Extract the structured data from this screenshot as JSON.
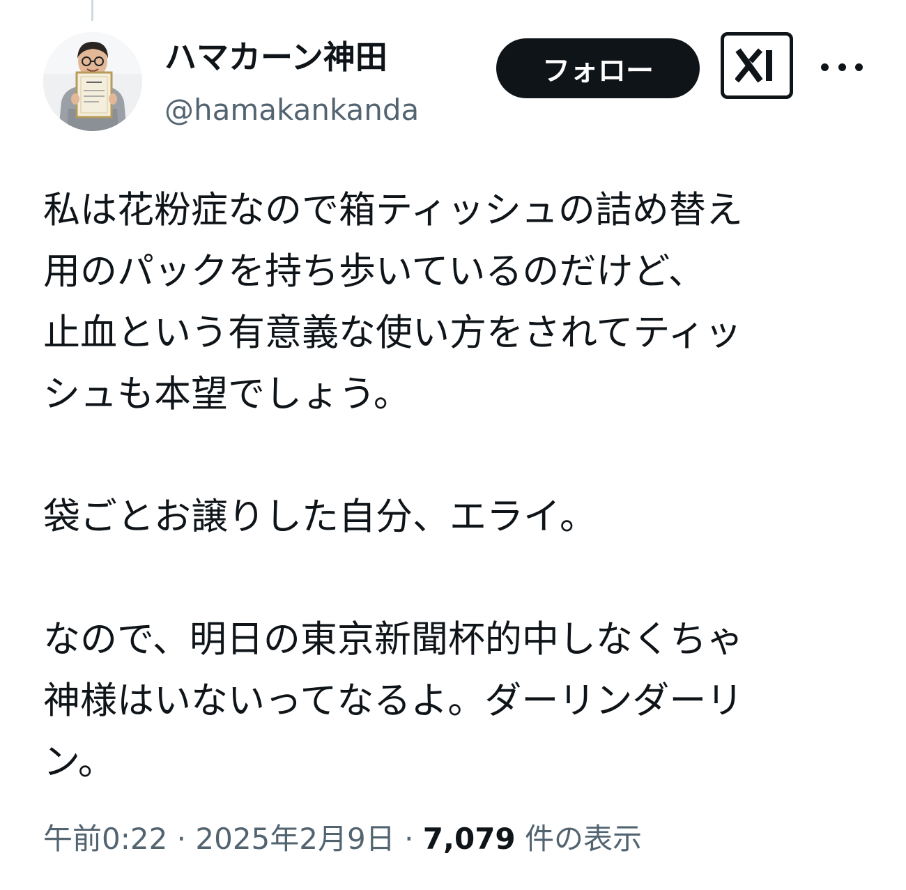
{
  "author": {
    "display_name": "ハマカーン神田",
    "handle": "@hamakankanda",
    "avatar_icon": "avatar-photo-holding-certificate"
  },
  "actions": {
    "follow_label": "フォロー",
    "grok_icon": "grok-icon",
    "more_icon": "more-dots-icon"
  },
  "tweet": {
    "paragraphs": [
      [
        "私は花粉症なので箱ティッシュの詰め替え",
        "用のパックを持ち歩いているのだけど、",
        "止血という有意義な使い方をされてティッ",
        "シュも本望でしょう。"
      ],
      [
        "袋ごとお譲りした自分、エライ。"
      ],
      [
        "なので、明日の東京新聞杯的中しなくちゃ",
        "神様はいないってなるよ。ダーリンダーリ",
        "ン。"
      ]
    ]
  },
  "meta": {
    "time": "午前0:22",
    "separator": " · ",
    "date": "2025年2月9日",
    "views_count": "7,079",
    "views_label": " 件の表示"
  },
  "colors": {
    "text_primary": "#0f1419",
    "text_secondary": "#536471",
    "follow_bg": "#0f1419",
    "thread_line": "#cfd9de"
  }
}
